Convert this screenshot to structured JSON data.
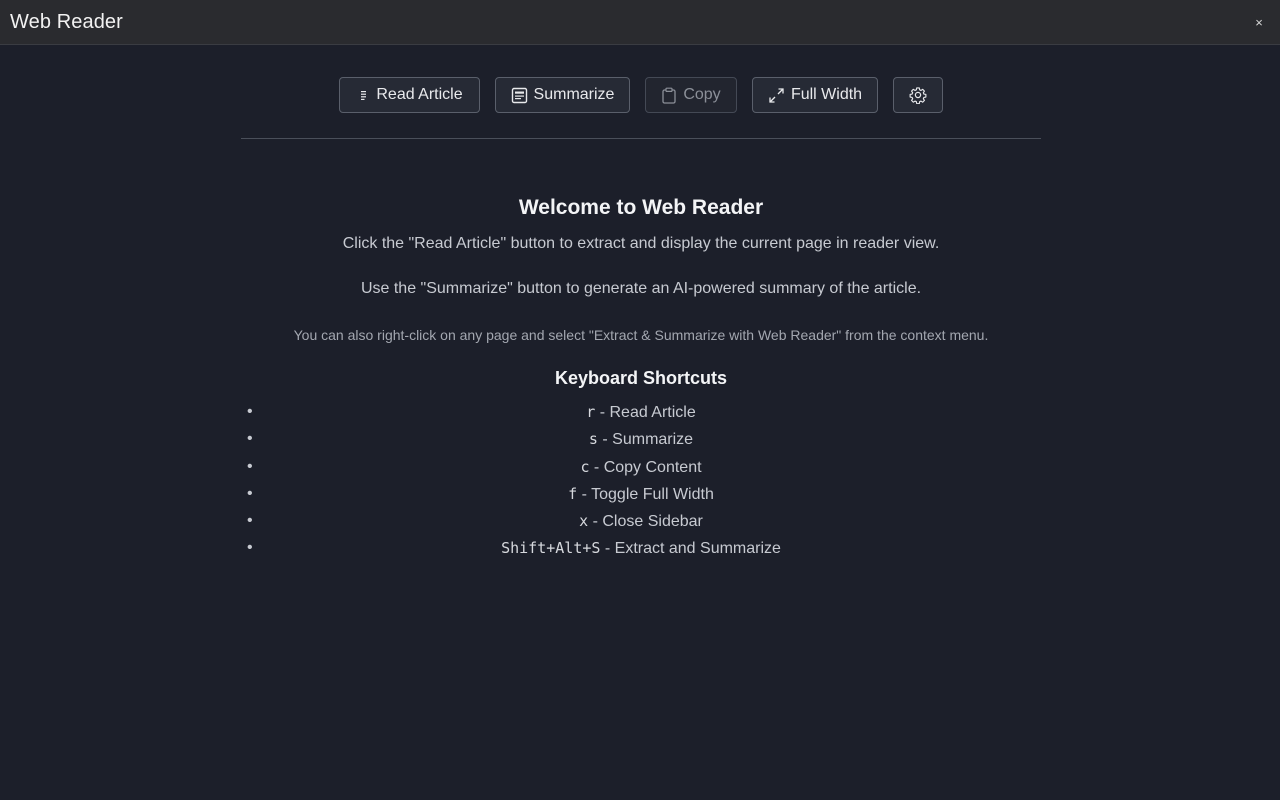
{
  "app": {
    "title": "Web Reader",
    "close_icon": "×"
  },
  "toolbar": {
    "read_label": "Read Article",
    "summarize_label": "Summarize",
    "copy_label": "Copy",
    "fullwidth_label": "Full Width"
  },
  "welcome": {
    "title": "Welcome to Web Reader",
    "p1": "Click the \"Read Article\" button to extract and display the current page in reader view.",
    "p2": "Use the \"Summarize\" button to generate an AI-powered summary of the article.",
    "p3": "You can also right-click on any page and select \"Extract & Summarize with Web Reader\" from the context menu."
  },
  "shortcuts": {
    "title": "Keyboard Shortcuts",
    "items": [
      {
        "key": "r",
        "desc": " - Read Article"
      },
      {
        "key": "s",
        "desc": " - Summarize"
      },
      {
        "key": "c",
        "desc": " - Copy Content"
      },
      {
        "key": "f",
        "desc": " - Toggle Full Width"
      },
      {
        "key": "x",
        "desc": " - Close Sidebar"
      },
      {
        "key": "Shift+Alt+S",
        "desc": " - Extract and Summarize"
      }
    ]
  },
  "colors": {
    "background": "#1c1f2a",
    "titlebar": "#2a2b2f",
    "button_border": "#5a5f6b",
    "text": "#c7cad1"
  },
  "icons": {
    "read": "lines-icon",
    "summarize": "document-icon",
    "copy": "clipboard-icon",
    "fullwidth": "expand-arrows-icon",
    "settings": "gear-icon"
  }
}
